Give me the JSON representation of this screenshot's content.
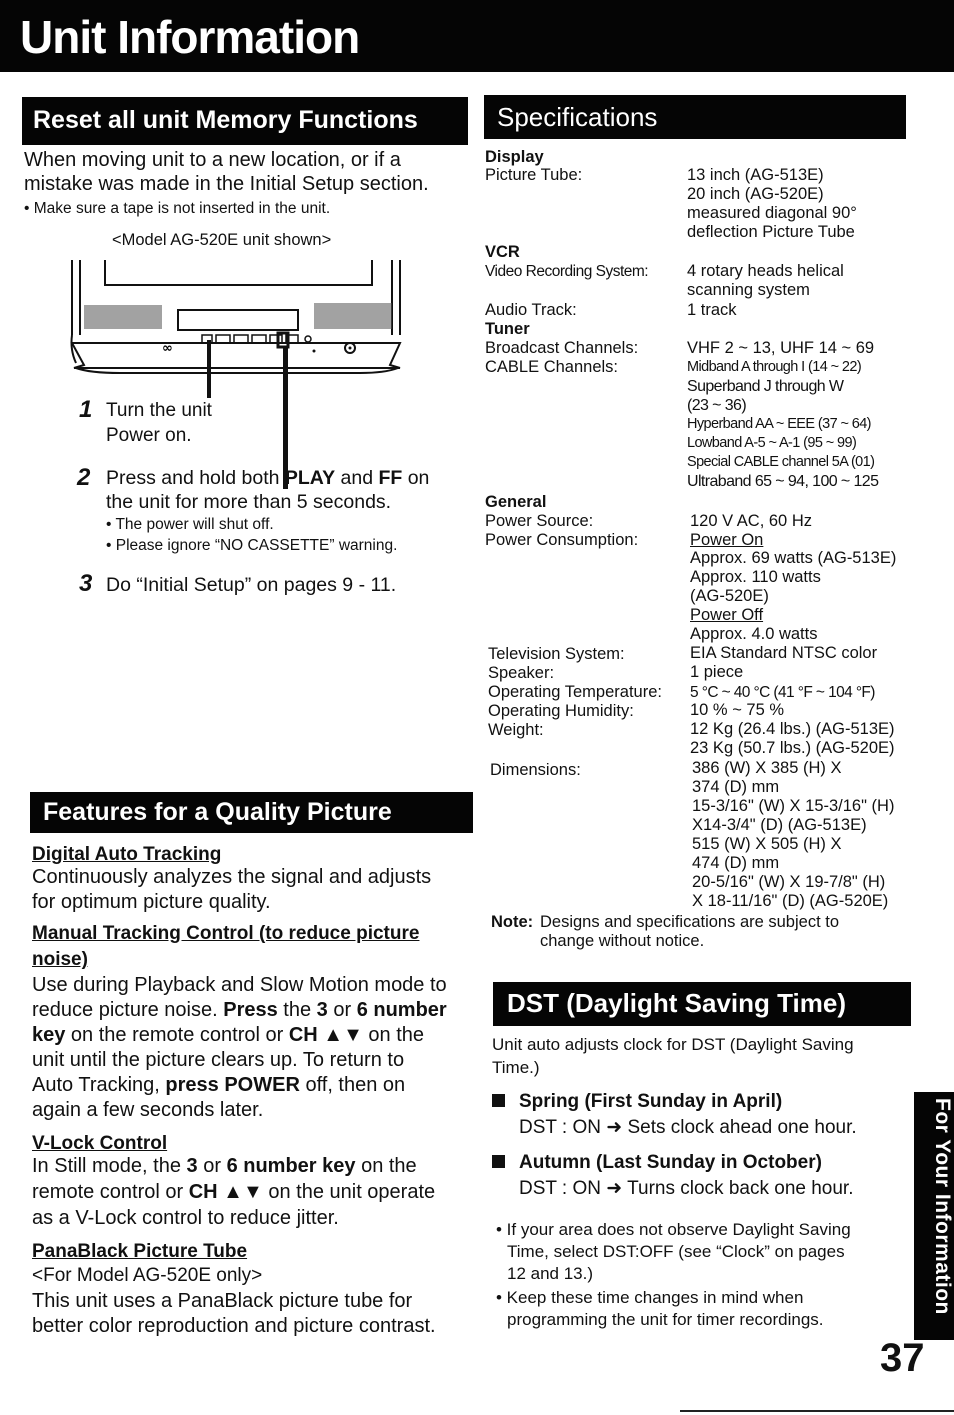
{
  "page": {
    "title": "Unit Information",
    "page_number": "37",
    "side_tab": "For Your Information"
  },
  "reset": {
    "heading": "Reset all unit Memory Functions",
    "intro_line1": "When moving unit to a new location, or if a",
    "intro_line2": "mistake was made in the Initial Setup section.",
    "note": "• Make sure a tape is not inserted in the unit.",
    "figure_caption": "<Model AG-520E unit shown>",
    "steps": [
      {
        "num": "1",
        "line1": "Turn the unit",
        "line2": "Power on."
      },
      {
        "num": "2",
        "line1_a": "Press and hold both ",
        "line1_b": "PLAY",
        "line1_c": " and ",
        "line1_d": "FF",
        "line1_e": " on",
        "line2": "the unit for more than 5 seconds.",
        "sub1": "• The power will shut off.",
        "sub2": "• Please ignore “NO CASSETTE” warning."
      },
      {
        "num": "3",
        "line1": "Do “Initial Setup” on pages 9 - 11."
      }
    ]
  },
  "features": {
    "heading": "Features for a Quality Picture",
    "items": [
      {
        "title": "Digital Auto Tracking",
        "lines": [
          "Continuously analyzes the signal and adjusts",
          "for optimum picture quality."
        ]
      },
      {
        "title_line1": "Manual Tracking Control (to reduce picture",
        "title_line2": "noise)",
        "lines": [
          [
            "Use during Playback and Slow Motion mode to"
          ],
          [
            "reduce picture noise. ",
            "Press",
            " the ",
            "3",
            " or ",
            "6 number"
          ],
          [
            "key",
            " on the remote control or ",
            "CH ▲▼",
            " on the"
          ],
          [
            "unit until the picture clears up. To return to"
          ],
          [
            "Auto Tracking, ",
            "press POWER",
            " off, then on"
          ],
          [
            "again a few seconds later."
          ]
        ]
      },
      {
        "title": "V-Lock Control",
        "lines": [
          [
            "In Still mode, the ",
            "3",
            " or ",
            "6 number key",
            " on the"
          ],
          [
            "remote control or ",
            "CH ▲▼",
            " on the unit operate"
          ],
          [
            "as a V-Lock control to reduce jitter."
          ]
        ]
      },
      {
        "title": "PanaBlack Picture Tube",
        "lines": [
          "<For Model AG-520E only>",
          "This unit uses a PanaBlack picture tube for",
          "better color reproduction and picture contrast."
        ]
      }
    ]
  },
  "specs": {
    "heading": "Specifications",
    "display": {
      "category": "Display",
      "picture_tube_label": "Picture Tube:",
      "picture_tube_values": [
        "13 inch (AG-513E)",
        "20 inch  (AG-520E)",
        "measured diagonal 90°",
        "deflection Picture Tube"
      ]
    },
    "vcr": {
      "category": "VCR",
      "video_label": "Video Recording System:",
      "video_values": [
        "4 rotary heads helical",
        "scanning system"
      ],
      "audio_label": "Audio Track:",
      "audio_value": "1 track"
    },
    "tuner": {
      "category": "Tuner",
      "broadcast_label": "Broadcast Channels:",
      "broadcast_value": "VHF 2 ~ 13, UHF 14 ~ 69",
      "cable_label": "CABLE Channels:",
      "cable_values": [
        "Midband A through I (14 ~ 22)",
        "Superband J through W",
        "(23 ~ 36)",
        "Hyperband AA ~ EEE (37 ~ 64)",
        "Lowband A-5 ~ A-1 (95 ~ 99)",
        "Special CABLE channel 5A (01)",
        "Ultraband 65 ~ 94, 100 ~ 125"
      ]
    },
    "general": {
      "category": "General",
      "power_source_label": "Power Source:",
      "power_source_value": "120 V AC, 60 Hz",
      "consumption_label": "Power Consumption:",
      "power_on_label": "Power On",
      "power_on_values": [
        "Approx. 69 watts (AG-513E)",
        "Approx. 110 watts",
        "(AG-520E)"
      ],
      "power_off_label": "Power Off",
      "power_off_value": "Approx. 4.0 watts",
      "tv_system_label": "Television System:",
      "tv_system_value": "EIA Standard NTSC color",
      "speaker_label": "Speaker:",
      "speaker_value": "1 piece",
      "temp_label": "Operating Temperature:",
      "temp_value": "5 °C ~ 40 °C (41 °F ~ 104 °F)",
      "humidity_label": "Operating Humidity:",
      "humidity_value": "10 % ~ 75 %",
      "weight_label": "Weight:",
      "weight_values": [
        "12 Kg (26.4 lbs.) (AG-513E)",
        "23 Kg (50.7 lbs.) (AG-520E)"
      ],
      "dimensions_label": "Dimensions:",
      "dimensions_values": [
        "386 (W) X 385 (H) X",
        "374 (D) mm",
        "15-3/16\" (W) X 15-3/16\" (H)",
        "X14-3/4\" (D) (AG-513E)",
        "515 (W) X 505 (H) X",
        "474 (D) mm",
        "20-5/16\" (W) X 19-7/8\" (H)",
        "X 18-11/16\" (D) (AG-520E)"
      ]
    },
    "note_label": "Note:",
    "note_line1": "Designs and specifications are subject to",
    "note_line2": "change without notice."
  },
  "dst": {
    "heading": "DST (Daylight Saving Time)",
    "intro_line1": "Unit auto adjusts clock for DST (Daylight Saving",
    "intro_line2": "Time.)",
    "items": [
      {
        "title": "Spring (First Sunday in April)",
        "detail": "DST : ON ➜ Sets clock ahead one hour."
      },
      {
        "title": "Autumn (Last Sunday in October)",
        "detail": "DST : ON ➜ Turns clock back one hour."
      }
    ],
    "notes": [
      {
        "line1": "• If your area does not observe Daylight Saving",
        "line2": "Time, select DST:OFF (see “Clock” on pages",
        "line3": "12 and 13.)"
      },
      {
        "line1": "• Keep these time changes in mind when",
        "line2": "programming the unit for timer recordings."
      }
    ]
  }
}
